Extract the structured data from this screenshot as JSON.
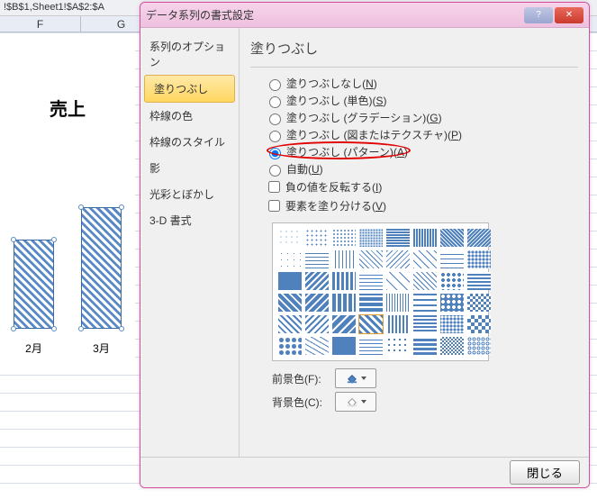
{
  "spreadsheet": {
    "formula": "!$B$1,Sheet1!$A$2:$A",
    "cols": [
      "F",
      "G"
    ]
  },
  "chart_data": {
    "type": "bar",
    "title": "売上",
    "categories": [
      "2月",
      "3月"
    ],
    "values": [
      110,
      150
    ],
    "ylim": [
      0,
      200
    ]
  },
  "dialog": {
    "title": "データ系列の書式設定",
    "help_icon": "?",
    "close_icon": "✕",
    "sidebar": {
      "items": [
        {
          "label": "系列のオプション"
        },
        {
          "label": "塗りつぶし",
          "active": true
        },
        {
          "label": "枠線の色"
        },
        {
          "label": "枠線のスタイル"
        },
        {
          "label": "影"
        },
        {
          "label": "光彩とぼかし"
        },
        {
          "label": "3-D 書式"
        }
      ]
    },
    "section_title": "塗りつぶし",
    "radios": [
      {
        "label": "塗りつぶしなし(",
        "u": "N",
        "tail": ")",
        "checked": false
      },
      {
        "label": "塗りつぶし (単色)(",
        "u": "S",
        "tail": ")",
        "checked": false
      },
      {
        "label": "塗りつぶし (グラデーション)(",
        "u": "G",
        "tail": ")",
        "checked": false
      },
      {
        "label": "塗りつぶし (図またはテクスチャ)(",
        "u": "P",
        "tail": ")",
        "checked": false
      },
      {
        "label": "塗りつぶし (パターン)(",
        "u": "A",
        "tail": ")",
        "checked": true,
        "highlight": true
      },
      {
        "label": "自動(",
        "u": "U",
        "tail": ")",
        "checked": false
      }
    ],
    "checks": [
      {
        "label": "負の値を反転する(",
        "u": "I",
        "tail": ")",
        "checked": false
      },
      {
        "label": "要素を塗り分ける(",
        "u": "V",
        "tail": ")",
        "checked": false
      }
    ],
    "foreground_label": "前景色(",
    "foreground_u": "F",
    "foreground_tail": "):",
    "background_label": "背景色(",
    "background_u": "C",
    "background_tail": "):",
    "close_btn": "閉じる"
  },
  "colors": {
    "pattern_fg": "#4f81bd",
    "pattern_bg": "#ffffff",
    "accent": "#5a8ac6"
  },
  "patterns": {
    "selected_index": 35,
    "count": 48
  }
}
